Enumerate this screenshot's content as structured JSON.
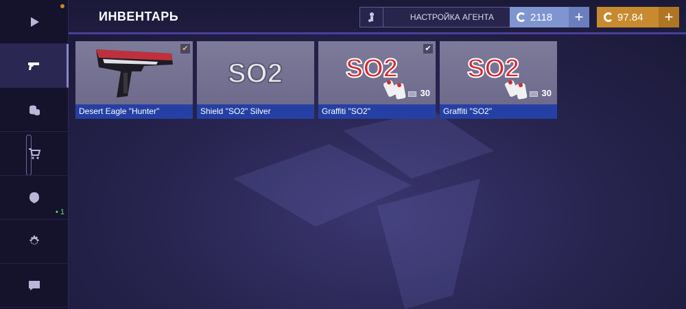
{
  "header": {
    "title": "ИНВЕНТАРЬ",
    "agent_button": "НАСТРОЙКА АГЕНТА",
    "credits": "2118",
    "gold": "97.84",
    "plus": "+"
  },
  "sidebar": {
    "items": [
      {
        "name": "play",
        "icon": "play-icon"
      },
      {
        "name": "inventory",
        "icon": "pistol-icon",
        "active": true
      },
      {
        "name": "cases",
        "icon": "coins-icon"
      },
      {
        "name": "market",
        "icon": "cart-icon"
      },
      {
        "name": "clan",
        "icon": "shield-helmet-icon",
        "badge": "• 1"
      },
      {
        "name": "settings",
        "icon": "gear-icon"
      },
      {
        "name": "chat",
        "icon": "chat-icon"
      }
    ]
  },
  "inventory": {
    "items": [
      {
        "name": "Desert Eagle \"Hunter\"",
        "art": "pistol",
        "checked": true,
        "check_color": "#e9b45a"
      },
      {
        "name": "Shield \"SO2\" Silver",
        "art": "so2-silver",
        "checked": false
      },
      {
        "name": "Graffiti \"SO2\"",
        "art": "so2-graffiti",
        "checked": true,
        "check_color": "#ffffff",
        "count": "30"
      },
      {
        "name": "Graffiti \"SO2\"",
        "art": "so2-graffiti",
        "checked": false,
        "count": "30"
      }
    ]
  },
  "colors": {
    "name_bar": "#2540a4",
    "credits": "#7f95d0",
    "gold": "#c78a2e",
    "accent": "#4b3f9c"
  }
}
